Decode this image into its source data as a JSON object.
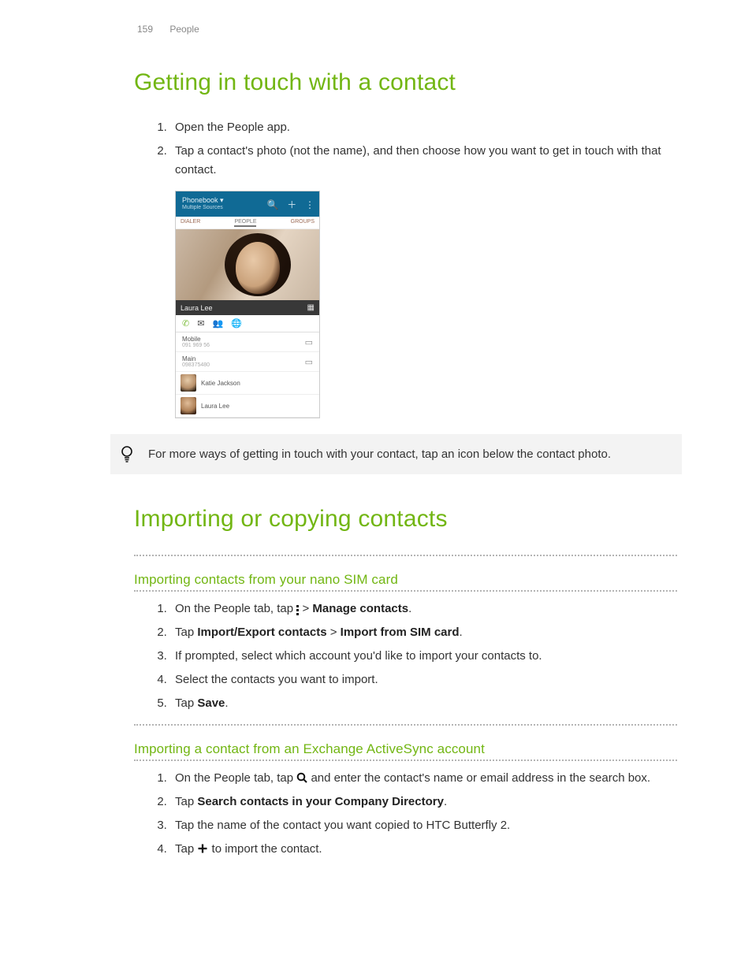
{
  "header": {
    "page_number": "159",
    "section": "People"
  },
  "section1": {
    "title": "Getting in touch with a contact",
    "steps": [
      "Open the People app.",
      "Tap a contact's photo (not the name), and then choose how you want to get in touch with that contact."
    ]
  },
  "phone_mock": {
    "topbar_title": "Phonebook ▾",
    "topbar_sub": "Multiple Sources",
    "tabs": [
      "DIALER",
      "PEOPLE",
      "GROUPS"
    ],
    "contact_name": "Laura Lee",
    "rows": [
      {
        "label": "Mobile",
        "num": "091 969 56"
      },
      {
        "label": "Main",
        "num": "098375480"
      }
    ],
    "list": [
      "Katie Jackson",
      "Laura Lee"
    ]
  },
  "tip": "For more ways of getting in touch with your contact, tap an icon below the contact photo.",
  "section2": {
    "title": "Importing or copying contacts",
    "sub1": {
      "heading": "Importing contacts from your nano SIM card",
      "step1_a": "On the People tab, tap ",
      "step1_b": " > ",
      "step1_bold": "Manage contacts",
      "step1_c": ".",
      "step2_a": "Tap ",
      "step2_bold1": "Import/Export contacts",
      "step2_b": " > ",
      "step2_bold2": "Import from SIM card",
      "step2_c": ".",
      "step3": "If prompted, select which account you'd like to import your contacts to.",
      "step4": "Select the contacts you want to import.",
      "step5_a": "Tap ",
      "step5_bold": "Save",
      "step5_b": "."
    },
    "sub2": {
      "heading": "Importing a contact from an Exchange ActiveSync account",
      "step1_a": "On the People tab, tap ",
      "step1_b": " and enter the contact's name or email address in the search box.",
      "step2_a": "Tap ",
      "step2_bold": "Search contacts in your Company Directory",
      "step2_b": ".",
      "step3": "Tap the name of the contact you want copied to HTC Butterfly 2.",
      "step4_a": "Tap ",
      "step4_b": " to import the contact."
    }
  }
}
